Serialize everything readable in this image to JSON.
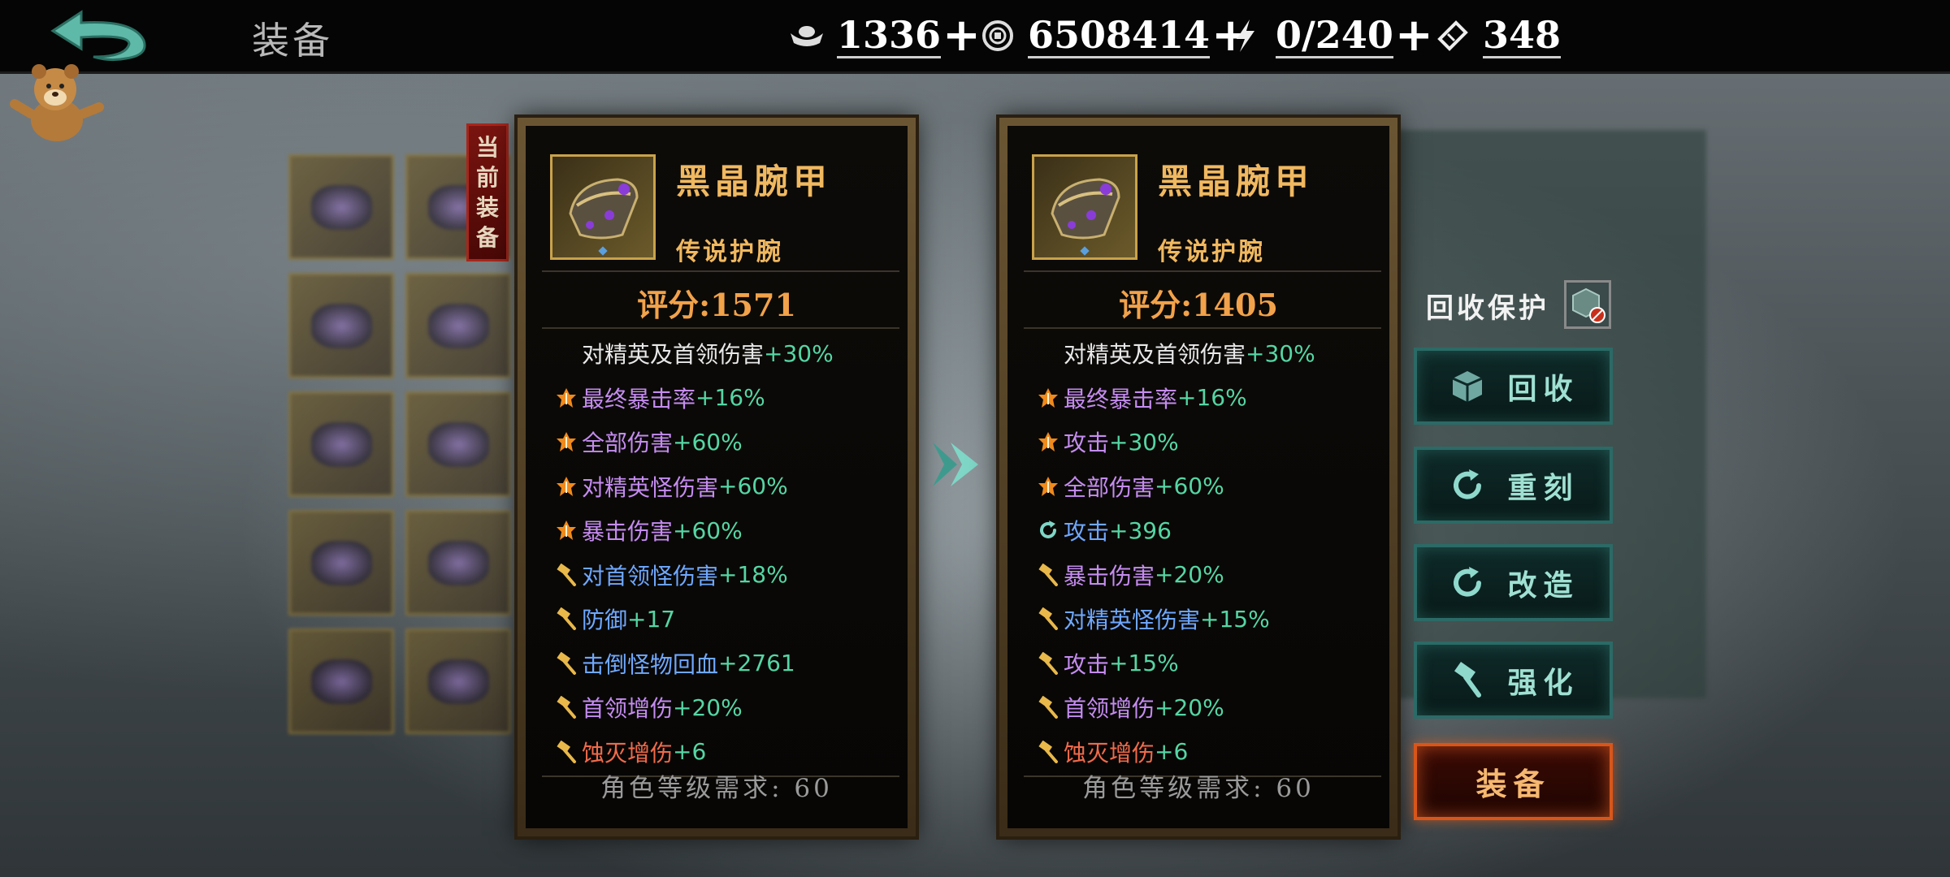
{
  "header": {
    "title": "装备",
    "currencies": [
      {
        "icon": "silver-ingot-icon",
        "value": "1336"
      },
      {
        "icon": "coin-icon",
        "value": "6508414"
      },
      {
        "icon": "lightning-icon",
        "value": "0/240"
      },
      {
        "icon": "ticket-icon",
        "value": "348"
      }
    ]
  },
  "current_tag": [
    "当",
    "前",
    "装",
    "备"
  ],
  "left_item": {
    "name": "黑晶腕甲",
    "type": "传说护腕",
    "score": "评分:1571",
    "stats": [
      {
        "icon": "none",
        "label": "对精英及首领伤害",
        "bonus": "+30%",
        "color": "#e8e8e8"
      },
      {
        "icon": "orange-star-icon",
        "label": "最终暴击率",
        "bonus": "+16%",
        "color": "#c58cf0"
      },
      {
        "icon": "orange-star-icon",
        "label": "全部伤害",
        "bonus": "+60%",
        "color": "#c58cf0"
      },
      {
        "icon": "orange-star-icon",
        "label": "对精英怪伤害",
        "bonus": "+60%",
        "color": "#c58cf0"
      },
      {
        "icon": "orange-star-icon",
        "label": "暴击伤害",
        "bonus": "+60%",
        "color": "#c58cf0"
      },
      {
        "icon": "hammer-icon",
        "label": "对首领怪伤害",
        "bonus": "+18%",
        "color": "#6fa8ff"
      },
      {
        "icon": "hammer-icon",
        "label": "防御",
        "bonus": "+17",
        "color": "#6fa8ff"
      },
      {
        "icon": "hammer-icon",
        "label": "击倒怪物回血",
        "bonus": "+2761",
        "color": "#6fa8ff"
      },
      {
        "icon": "hammer-icon",
        "label": "首领增伤",
        "bonus": "+20%",
        "color": "#c58cf0"
      },
      {
        "icon": "hammer-icon",
        "label": "蚀灭增伤",
        "bonus": "+6",
        "color": "#f06a4a"
      }
    ],
    "requirement": "角色等级需求:  60"
  },
  "right_item": {
    "name": "黑晶腕甲",
    "type": "传说护腕",
    "score": "评分:1405",
    "stats": [
      {
        "icon": "none",
        "label": "对精英及首领伤害",
        "bonus": "+30%",
        "color": "#e8e8e8"
      },
      {
        "icon": "orange-star-icon",
        "label": "最终暴击率",
        "bonus": "+16%",
        "color": "#c58cf0"
      },
      {
        "icon": "orange-star-icon",
        "label": "攻击",
        "bonus": "+30%",
        "color": "#c58cf0"
      },
      {
        "icon": "orange-star-icon",
        "label": "全部伤害",
        "bonus": "+60%",
        "color": "#c58cf0"
      },
      {
        "icon": "cycle-icon",
        "label": "攻击",
        "bonus": "+396",
        "color": "#6fa8ff"
      },
      {
        "icon": "hammer-icon",
        "label": "暴击伤害",
        "bonus": "+20%",
        "color": "#c58cf0"
      },
      {
        "icon": "hammer-icon",
        "label": "对精英怪伤害",
        "bonus": "+15%",
        "color": "#6fa8ff"
      },
      {
        "icon": "hammer-icon",
        "label": "攻击",
        "bonus": "+15%",
        "color": "#c58cf0"
      },
      {
        "icon": "hammer-icon",
        "label": "首领增伤",
        "bonus": "+20%",
        "color": "#c58cf0"
      },
      {
        "icon": "hammer-icon",
        "label": "蚀灭增伤",
        "bonus": "+6",
        "color": "#f06a4a"
      }
    ],
    "requirement": "角色等级需求:  60"
  },
  "actions": {
    "protect_label": "回收保护",
    "recycle": "回收",
    "reforge": "重刻",
    "modify": "改造",
    "enhance": "强化",
    "equip": "装备"
  },
  "colors": {
    "bonus_green": "#55d6a4",
    "score_orange": "#f2a24a",
    "name_gold": "#f0b860"
  }
}
